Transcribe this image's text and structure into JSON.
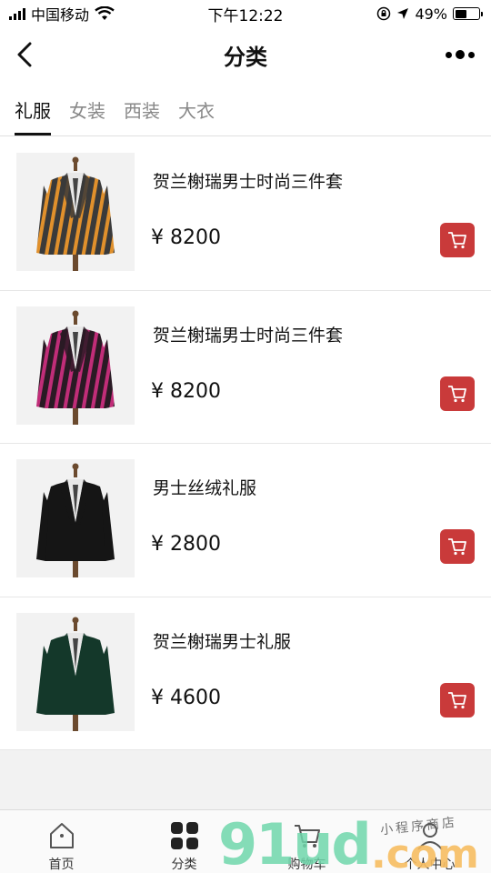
{
  "status_bar": {
    "carrier": "中国移动",
    "time": "下午12:22",
    "battery_text": "49%",
    "battery_level": 0.49
  },
  "nav": {
    "title": "分类"
  },
  "tabs": [
    {
      "label": "礼服",
      "active": true
    },
    {
      "label": "女装",
      "active": false
    },
    {
      "label": "西装",
      "active": false
    },
    {
      "label": "大衣",
      "active": false
    }
  ],
  "products": [
    {
      "name": "贺兰榭瑞男士时尚三件套",
      "price": "¥ 8200",
      "jacket_color": "#3a3a3a",
      "stripe_color": "#e0902c"
    },
    {
      "name": "贺兰榭瑞男士时尚三件套",
      "price": "¥ 8200",
      "jacket_color": "#2a1a24",
      "stripe_color": "#c02d78"
    },
    {
      "name": "男士丝绒礼服",
      "price": "¥ 2800",
      "jacket_color": "#151515",
      "stripe_color": "#151515"
    },
    {
      "name": "贺兰榭瑞男士礼服",
      "price": "¥ 4600",
      "jacket_color": "#14382a",
      "stripe_color": "#14382a"
    }
  ],
  "tab_bar": [
    {
      "label": "首页",
      "icon": "home-icon"
    },
    {
      "label": "分类",
      "icon": "category-icon"
    },
    {
      "label": "购物车",
      "icon": "cart-icon"
    },
    {
      "label": "个人中心",
      "icon": "user-icon"
    }
  ],
  "watermark": {
    "main": "91ud",
    "domain": ".com",
    "subtitle": "小程序商店"
  },
  "colors": {
    "accent": "#c93a3a",
    "tab_active": "#111111",
    "tab_inactive": "#888888"
  }
}
